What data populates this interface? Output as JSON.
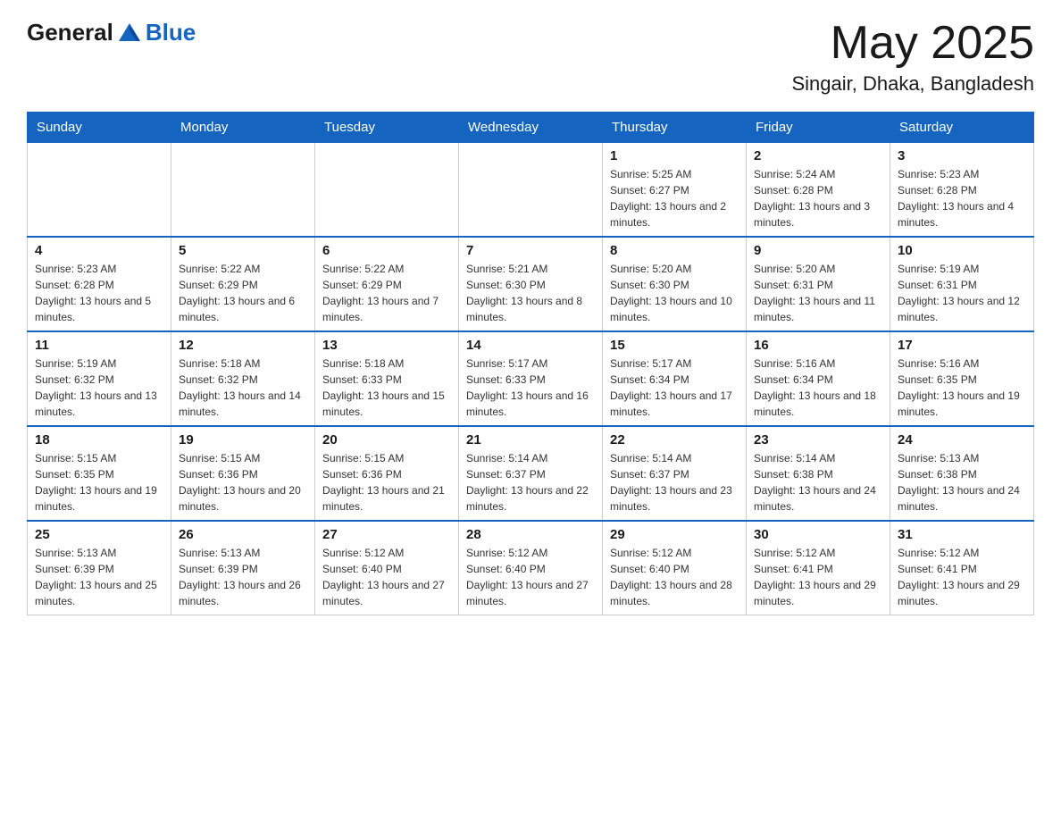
{
  "logo": {
    "general": "General",
    "blue": "Blue"
  },
  "header": {
    "month": "May 2025",
    "location": "Singair, Dhaka, Bangladesh"
  },
  "weekdays": [
    "Sunday",
    "Monday",
    "Tuesday",
    "Wednesday",
    "Thursday",
    "Friday",
    "Saturday"
  ],
  "weeks": [
    [
      {
        "day": "",
        "info": ""
      },
      {
        "day": "",
        "info": ""
      },
      {
        "day": "",
        "info": ""
      },
      {
        "day": "",
        "info": ""
      },
      {
        "day": "1",
        "info": "Sunrise: 5:25 AM\nSunset: 6:27 PM\nDaylight: 13 hours and 2 minutes."
      },
      {
        "day": "2",
        "info": "Sunrise: 5:24 AM\nSunset: 6:28 PM\nDaylight: 13 hours and 3 minutes."
      },
      {
        "day": "3",
        "info": "Sunrise: 5:23 AM\nSunset: 6:28 PM\nDaylight: 13 hours and 4 minutes."
      }
    ],
    [
      {
        "day": "4",
        "info": "Sunrise: 5:23 AM\nSunset: 6:28 PM\nDaylight: 13 hours and 5 minutes."
      },
      {
        "day": "5",
        "info": "Sunrise: 5:22 AM\nSunset: 6:29 PM\nDaylight: 13 hours and 6 minutes."
      },
      {
        "day": "6",
        "info": "Sunrise: 5:22 AM\nSunset: 6:29 PM\nDaylight: 13 hours and 7 minutes."
      },
      {
        "day": "7",
        "info": "Sunrise: 5:21 AM\nSunset: 6:30 PM\nDaylight: 13 hours and 8 minutes."
      },
      {
        "day": "8",
        "info": "Sunrise: 5:20 AM\nSunset: 6:30 PM\nDaylight: 13 hours and 10 minutes."
      },
      {
        "day": "9",
        "info": "Sunrise: 5:20 AM\nSunset: 6:31 PM\nDaylight: 13 hours and 11 minutes."
      },
      {
        "day": "10",
        "info": "Sunrise: 5:19 AM\nSunset: 6:31 PM\nDaylight: 13 hours and 12 minutes."
      }
    ],
    [
      {
        "day": "11",
        "info": "Sunrise: 5:19 AM\nSunset: 6:32 PM\nDaylight: 13 hours and 13 minutes."
      },
      {
        "day": "12",
        "info": "Sunrise: 5:18 AM\nSunset: 6:32 PM\nDaylight: 13 hours and 14 minutes."
      },
      {
        "day": "13",
        "info": "Sunrise: 5:18 AM\nSunset: 6:33 PM\nDaylight: 13 hours and 15 minutes."
      },
      {
        "day": "14",
        "info": "Sunrise: 5:17 AM\nSunset: 6:33 PM\nDaylight: 13 hours and 16 minutes."
      },
      {
        "day": "15",
        "info": "Sunrise: 5:17 AM\nSunset: 6:34 PM\nDaylight: 13 hours and 17 minutes."
      },
      {
        "day": "16",
        "info": "Sunrise: 5:16 AM\nSunset: 6:34 PM\nDaylight: 13 hours and 18 minutes."
      },
      {
        "day": "17",
        "info": "Sunrise: 5:16 AM\nSunset: 6:35 PM\nDaylight: 13 hours and 19 minutes."
      }
    ],
    [
      {
        "day": "18",
        "info": "Sunrise: 5:15 AM\nSunset: 6:35 PM\nDaylight: 13 hours and 19 minutes."
      },
      {
        "day": "19",
        "info": "Sunrise: 5:15 AM\nSunset: 6:36 PM\nDaylight: 13 hours and 20 minutes."
      },
      {
        "day": "20",
        "info": "Sunrise: 5:15 AM\nSunset: 6:36 PM\nDaylight: 13 hours and 21 minutes."
      },
      {
        "day": "21",
        "info": "Sunrise: 5:14 AM\nSunset: 6:37 PM\nDaylight: 13 hours and 22 minutes."
      },
      {
        "day": "22",
        "info": "Sunrise: 5:14 AM\nSunset: 6:37 PM\nDaylight: 13 hours and 23 minutes."
      },
      {
        "day": "23",
        "info": "Sunrise: 5:14 AM\nSunset: 6:38 PM\nDaylight: 13 hours and 24 minutes."
      },
      {
        "day": "24",
        "info": "Sunrise: 5:13 AM\nSunset: 6:38 PM\nDaylight: 13 hours and 24 minutes."
      }
    ],
    [
      {
        "day": "25",
        "info": "Sunrise: 5:13 AM\nSunset: 6:39 PM\nDaylight: 13 hours and 25 minutes."
      },
      {
        "day": "26",
        "info": "Sunrise: 5:13 AM\nSunset: 6:39 PM\nDaylight: 13 hours and 26 minutes."
      },
      {
        "day": "27",
        "info": "Sunrise: 5:12 AM\nSunset: 6:40 PM\nDaylight: 13 hours and 27 minutes."
      },
      {
        "day": "28",
        "info": "Sunrise: 5:12 AM\nSunset: 6:40 PM\nDaylight: 13 hours and 27 minutes."
      },
      {
        "day": "29",
        "info": "Sunrise: 5:12 AM\nSunset: 6:40 PM\nDaylight: 13 hours and 28 minutes."
      },
      {
        "day": "30",
        "info": "Sunrise: 5:12 AM\nSunset: 6:41 PM\nDaylight: 13 hours and 29 minutes."
      },
      {
        "day": "31",
        "info": "Sunrise: 5:12 AM\nSunset: 6:41 PM\nDaylight: 13 hours and 29 minutes."
      }
    ]
  ]
}
